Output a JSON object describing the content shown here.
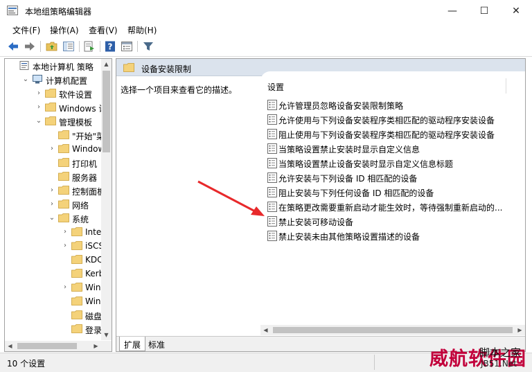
{
  "window": {
    "title": "本地组策略编辑器",
    "min_glyph": "—",
    "max_glyph": "☐",
    "close_glyph": "✕"
  },
  "menu": [
    "文件(F)",
    "操作(A)",
    "查看(V)",
    "帮助(H)"
  ],
  "toolbar_icons": [
    "back-icon",
    "forward-icon",
    "up-folder-icon",
    "show-hide-tree-icon",
    "export-list-icon",
    "help-icon",
    "properties-icon",
    "filter-icon"
  ],
  "tree": {
    "items": [
      {
        "label": "本地计算机 策略",
        "icon": "policy-icon"
      },
      {
        "label": "计算机配置",
        "icon": "computer-icon"
      },
      {
        "label": "软件设置",
        "icon": "folder-icon"
      },
      {
        "label": "Windows 设置",
        "icon": "folder-icon"
      },
      {
        "label": "管理模板",
        "icon": "folder-icon"
      },
      {
        "label": "\"开始\"菜单",
        "icon": "folder-icon"
      },
      {
        "label": "Windows",
        "icon": "folder-icon"
      },
      {
        "label": "打印机",
        "icon": "folder-icon"
      },
      {
        "label": "服务器",
        "icon": "folder-icon"
      },
      {
        "label": "控制面板",
        "icon": "folder-icon"
      },
      {
        "label": "网络",
        "icon": "folder-icon"
      },
      {
        "label": "系统",
        "icon": "folder-icon"
      },
      {
        "label": "Internet",
        "icon": "folder-icon"
      },
      {
        "label": "iSCSI",
        "icon": "folder-icon"
      },
      {
        "label": "KDC",
        "icon": "folder-icon"
      },
      {
        "label": "Kerberos",
        "icon": "folder-icon"
      },
      {
        "label": "Windows",
        "icon": "folder-icon"
      },
      {
        "label": "Windows",
        "icon": "folder-icon"
      },
      {
        "label": "磁盘配额",
        "icon": "folder-icon"
      },
      {
        "label": "登录",
        "icon": "folder-icon"
      }
    ]
  },
  "content": {
    "header": "设备安装限制",
    "description": "选择一个项目来查看它的描述。",
    "column_header": "设置",
    "policies": [
      "允许管理员忽略设备安装限制策略",
      "允许使用与下列设备安装程序类相匹配的驱动程序安装设备",
      "阻止使用与下列设备安装程序类相匹配的驱动程序安装设备",
      "当策略设置禁止安装时显示自定义信息",
      "当策略设置禁止设备安装时显示自定义信息标题",
      "允许安装与下列设备 ID 相匹配的设备",
      "阻止安装与下列任何设备 ID 相匹配的设备",
      "在策略更改需要重新启动才能生效时，等待强制重新启动的...",
      "禁止安装可移动设备",
      "禁止安装未由其他策略设置描述的设备"
    ]
  },
  "tabs": [
    "扩展",
    "标准"
  ],
  "status": "10 个设置",
  "watermark": {
    "main": "威航软件园",
    "sub": "脚本之家",
    "url": "JB51.Net"
  },
  "colors": {
    "header_bg": "#dbe3ed",
    "annotation_arrow": "#e8292b",
    "watermark": "#c2003b"
  }
}
